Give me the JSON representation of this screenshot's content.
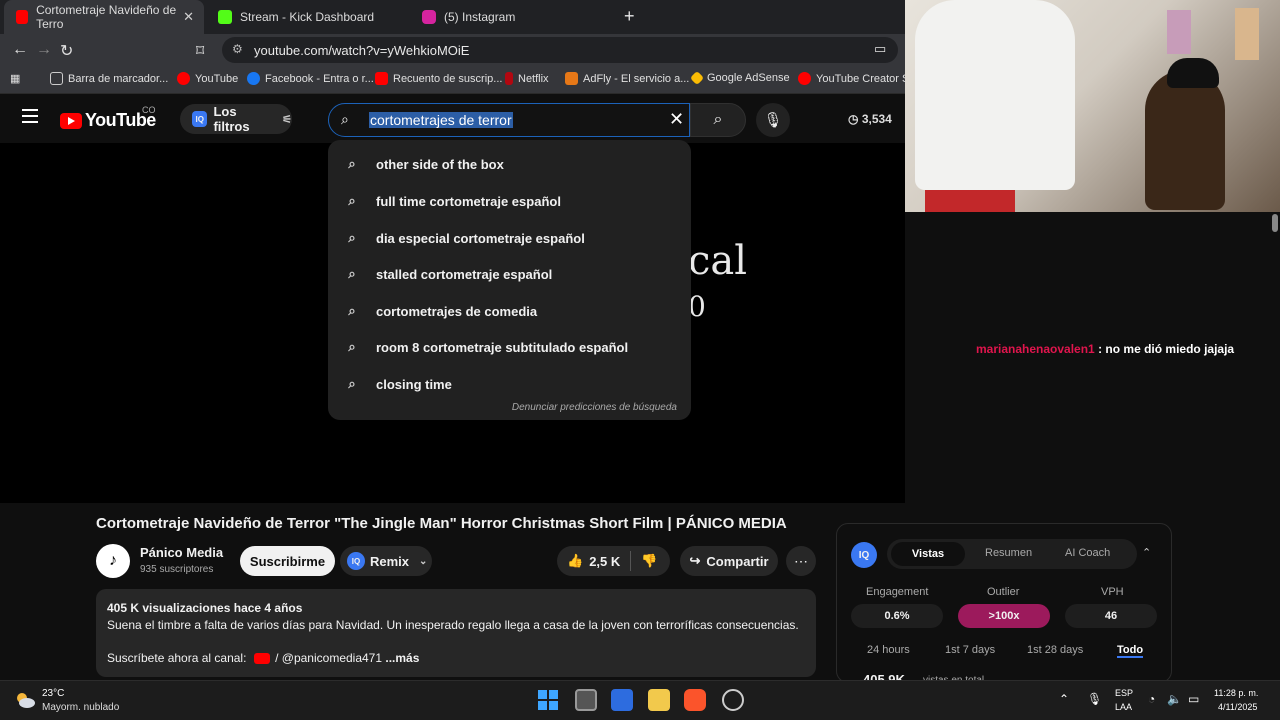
{
  "browser": {
    "tabs": [
      {
        "title": "Cortometraje Navideño de Terro",
        "active": true,
        "icon": "youtube-icon",
        "color": "#ff0000"
      },
      {
        "title": "Stream - Kick Dashboard",
        "active": false,
        "icon": "kick-icon",
        "color": "#53fc18"
      },
      {
        "title": "(5) Instagram",
        "active": false,
        "icon": "instagram-icon",
        "color": "#d6249f"
      }
    ],
    "url": "youtube.com/watch?v=yWehkioMOiE",
    "bookmarks": [
      "Barra de marcador...",
      "YouTube",
      "Facebook - Entra o r...",
      "Recuento de suscrip...",
      "Netflix",
      "AdFly - El servicio a...",
      "Google AdSense",
      "YouTube Creator St..."
    ]
  },
  "youtube": {
    "logo_text": "YouTube",
    "country": "CO",
    "filters_label": "Los filtros",
    "filters_badge": "IQ",
    "search_query": "cortometrajes de terror",
    "views_counter": "3,534",
    "suggestions": [
      "other side of the box",
      "full time cortometraje español",
      "dia especial cortometraje español",
      "stalled cortometraje español",
      "cortometrajes de comedia",
      "room 8 cortometraje subtitulado español",
      "closing time"
    ],
    "report_link": "Denunciar predicciones de búsqueda"
  },
  "video": {
    "overlay_text_1": "cal",
    "overlay_text_2": "0",
    "title": "Cortometraje Navideño de Terror \"The Jingle Man\" Horror Christmas Short Film | PÁNICO MEDIA",
    "channel_name": "Pánico Media",
    "channel_subs": "935 suscriptores",
    "subscribe_label": "Suscribirme",
    "remix_label": "Remix",
    "likes": "2,5 K",
    "share_label": "Compartir",
    "description": {
      "meta": "405 K visualizaciones  hace 4 años",
      "line": "Suena el timbre a falta de varios días para Navidad. Un inesperado regalo llega a casa de la joven con terroríficas consecuencias.",
      "subscribe_prefix": "Suscríbete ahora al canal:",
      "handle": "/ @panicomedia471",
      "more": "...más"
    }
  },
  "chat": {
    "user": "marianahenaovalen1",
    "message": ": no me dió miedo jajaja"
  },
  "iq_panel": {
    "logo": "IQ",
    "tabs": [
      "Vistas",
      "Resumen",
      "AI Coach"
    ],
    "metrics": [
      {
        "label": "Engagement",
        "value": "0.6%"
      },
      {
        "label": "Outlier",
        "value": ">100x",
        "highlight": "#9c1a5c"
      },
      {
        "label": "VPH",
        "value": "46"
      }
    ],
    "periods": [
      "24 hours",
      "1st 7 days",
      "1st 28 days",
      "Todo"
    ],
    "total_value": "405.9K",
    "total_label": "vistas en total"
  },
  "taskbar": {
    "weather_temp": "23°C",
    "weather_desc": "Mayorm. nublado",
    "lang_1": "ESP",
    "lang_2": "LAA",
    "time": "11:28 p. m.",
    "date": "4/11/2025"
  }
}
